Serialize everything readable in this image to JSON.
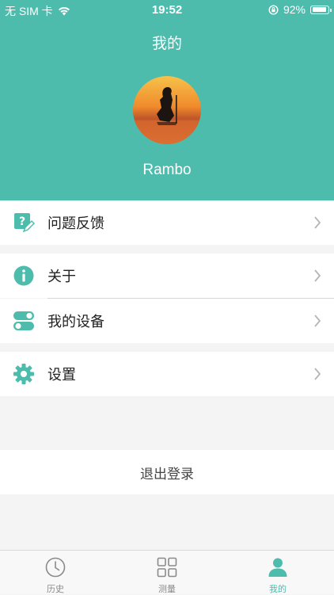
{
  "status_bar": {
    "carrier": "无 SIM 卡",
    "time": "19:52",
    "battery": "92%",
    "battery_level": 0.92
  },
  "header": {
    "title": "我的",
    "username": "Rambo"
  },
  "menu": {
    "feedback": "问题反馈",
    "about": "关于",
    "my_devices": "我的设备",
    "settings": "设置"
  },
  "logout_label": "退出登录",
  "tabs": {
    "history": "历史",
    "measure": "测量",
    "mine": "我的"
  },
  "colors": {
    "accent": "#4dbcad",
    "tab_inactive": "#8a8a8a"
  },
  "icons": [
    "wifi-icon",
    "orientation-lock-icon",
    "battery-icon",
    "feedback-icon",
    "info-icon",
    "toggle-icon",
    "gear-icon",
    "chevron-right-icon",
    "clock-icon",
    "grid-icon",
    "user-icon"
  ]
}
